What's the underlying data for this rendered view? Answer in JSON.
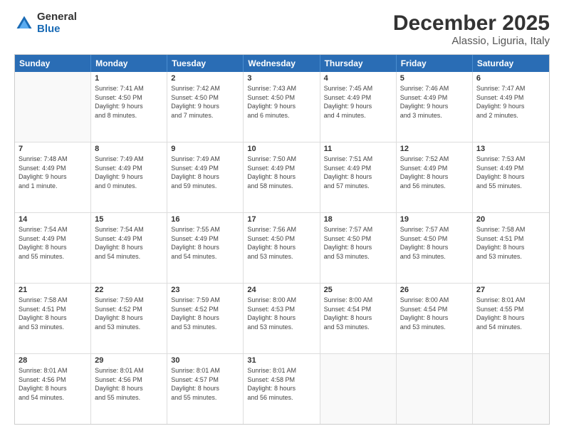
{
  "logo": {
    "general": "General",
    "blue": "Blue"
  },
  "title": "December 2025",
  "subtitle": "Alassio, Liguria, Italy",
  "header_days": [
    "Sunday",
    "Monday",
    "Tuesday",
    "Wednesday",
    "Thursday",
    "Friday",
    "Saturday"
  ],
  "weeks": [
    [
      {
        "day": "",
        "lines": []
      },
      {
        "day": "1",
        "lines": [
          "Sunrise: 7:41 AM",
          "Sunset: 4:50 PM",
          "Daylight: 9 hours",
          "and 8 minutes."
        ]
      },
      {
        "day": "2",
        "lines": [
          "Sunrise: 7:42 AM",
          "Sunset: 4:50 PM",
          "Daylight: 9 hours",
          "and 7 minutes."
        ]
      },
      {
        "day": "3",
        "lines": [
          "Sunrise: 7:43 AM",
          "Sunset: 4:50 PM",
          "Daylight: 9 hours",
          "and 6 minutes."
        ]
      },
      {
        "day": "4",
        "lines": [
          "Sunrise: 7:45 AM",
          "Sunset: 4:49 PM",
          "Daylight: 9 hours",
          "and 4 minutes."
        ]
      },
      {
        "day": "5",
        "lines": [
          "Sunrise: 7:46 AM",
          "Sunset: 4:49 PM",
          "Daylight: 9 hours",
          "and 3 minutes."
        ]
      },
      {
        "day": "6",
        "lines": [
          "Sunrise: 7:47 AM",
          "Sunset: 4:49 PM",
          "Daylight: 9 hours",
          "and 2 minutes."
        ]
      }
    ],
    [
      {
        "day": "7",
        "lines": [
          "Sunrise: 7:48 AM",
          "Sunset: 4:49 PM",
          "Daylight: 9 hours",
          "and 1 minute."
        ]
      },
      {
        "day": "8",
        "lines": [
          "Sunrise: 7:49 AM",
          "Sunset: 4:49 PM",
          "Daylight: 9 hours",
          "and 0 minutes."
        ]
      },
      {
        "day": "9",
        "lines": [
          "Sunrise: 7:49 AM",
          "Sunset: 4:49 PM",
          "Daylight: 8 hours",
          "and 59 minutes."
        ]
      },
      {
        "day": "10",
        "lines": [
          "Sunrise: 7:50 AM",
          "Sunset: 4:49 PM",
          "Daylight: 8 hours",
          "and 58 minutes."
        ]
      },
      {
        "day": "11",
        "lines": [
          "Sunrise: 7:51 AM",
          "Sunset: 4:49 PM",
          "Daylight: 8 hours",
          "and 57 minutes."
        ]
      },
      {
        "day": "12",
        "lines": [
          "Sunrise: 7:52 AM",
          "Sunset: 4:49 PM",
          "Daylight: 8 hours",
          "and 56 minutes."
        ]
      },
      {
        "day": "13",
        "lines": [
          "Sunrise: 7:53 AM",
          "Sunset: 4:49 PM",
          "Daylight: 8 hours",
          "and 55 minutes."
        ]
      }
    ],
    [
      {
        "day": "14",
        "lines": [
          "Sunrise: 7:54 AM",
          "Sunset: 4:49 PM",
          "Daylight: 8 hours",
          "and 55 minutes."
        ]
      },
      {
        "day": "15",
        "lines": [
          "Sunrise: 7:54 AM",
          "Sunset: 4:49 PM",
          "Daylight: 8 hours",
          "and 54 minutes."
        ]
      },
      {
        "day": "16",
        "lines": [
          "Sunrise: 7:55 AM",
          "Sunset: 4:49 PM",
          "Daylight: 8 hours",
          "and 54 minutes."
        ]
      },
      {
        "day": "17",
        "lines": [
          "Sunrise: 7:56 AM",
          "Sunset: 4:50 PM",
          "Daylight: 8 hours",
          "and 53 minutes."
        ]
      },
      {
        "day": "18",
        "lines": [
          "Sunrise: 7:57 AM",
          "Sunset: 4:50 PM",
          "Daylight: 8 hours",
          "and 53 minutes."
        ]
      },
      {
        "day": "19",
        "lines": [
          "Sunrise: 7:57 AM",
          "Sunset: 4:50 PM",
          "Daylight: 8 hours",
          "and 53 minutes."
        ]
      },
      {
        "day": "20",
        "lines": [
          "Sunrise: 7:58 AM",
          "Sunset: 4:51 PM",
          "Daylight: 8 hours",
          "and 53 minutes."
        ]
      }
    ],
    [
      {
        "day": "21",
        "lines": [
          "Sunrise: 7:58 AM",
          "Sunset: 4:51 PM",
          "Daylight: 8 hours",
          "and 53 minutes."
        ]
      },
      {
        "day": "22",
        "lines": [
          "Sunrise: 7:59 AM",
          "Sunset: 4:52 PM",
          "Daylight: 8 hours",
          "and 53 minutes."
        ]
      },
      {
        "day": "23",
        "lines": [
          "Sunrise: 7:59 AM",
          "Sunset: 4:52 PM",
          "Daylight: 8 hours",
          "and 53 minutes."
        ]
      },
      {
        "day": "24",
        "lines": [
          "Sunrise: 8:00 AM",
          "Sunset: 4:53 PM",
          "Daylight: 8 hours",
          "and 53 minutes."
        ]
      },
      {
        "day": "25",
        "lines": [
          "Sunrise: 8:00 AM",
          "Sunset: 4:54 PM",
          "Daylight: 8 hours",
          "and 53 minutes."
        ]
      },
      {
        "day": "26",
        "lines": [
          "Sunrise: 8:00 AM",
          "Sunset: 4:54 PM",
          "Daylight: 8 hours",
          "and 53 minutes."
        ]
      },
      {
        "day": "27",
        "lines": [
          "Sunrise: 8:01 AM",
          "Sunset: 4:55 PM",
          "Daylight: 8 hours",
          "and 54 minutes."
        ]
      }
    ],
    [
      {
        "day": "28",
        "lines": [
          "Sunrise: 8:01 AM",
          "Sunset: 4:56 PM",
          "Daylight: 8 hours",
          "and 54 minutes."
        ]
      },
      {
        "day": "29",
        "lines": [
          "Sunrise: 8:01 AM",
          "Sunset: 4:56 PM",
          "Daylight: 8 hours",
          "and 55 minutes."
        ]
      },
      {
        "day": "30",
        "lines": [
          "Sunrise: 8:01 AM",
          "Sunset: 4:57 PM",
          "Daylight: 8 hours",
          "and 55 minutes."
        ]
      },
      {
        "day": "31",
        "lines": [
          "Sunrise: 8:01 AM",
          "Sunset: 4:58 PM",
          "Daylight: 8 hours",
          "and 56 minutes."
        ]
      },
      {
        "day": "",
        "lines": []
      },
      {
        "day": "",
        "lines": []
      },
      {
        "day": "",
        "lines": []
      }
    ]
  ]
}
